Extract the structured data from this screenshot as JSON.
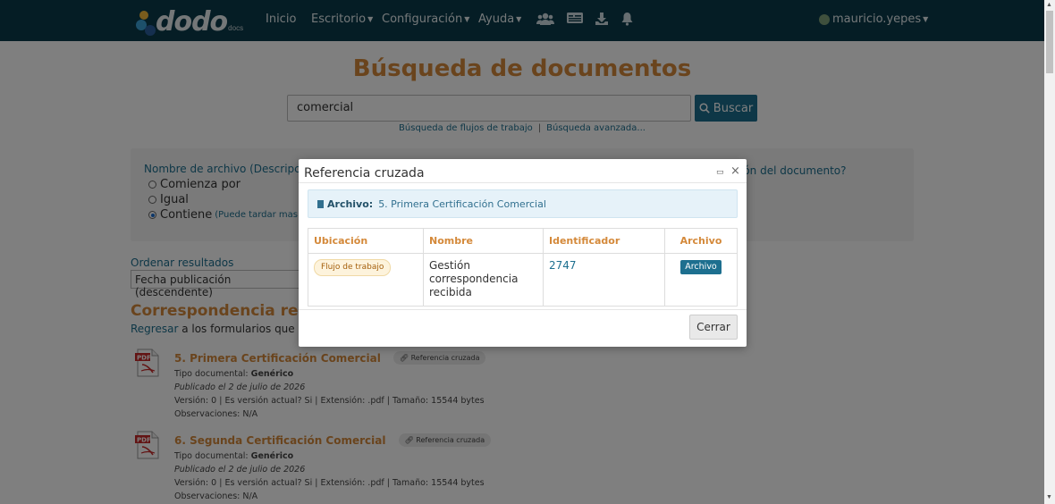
{
  "navbar": {
    "brand_word": "dodo",
    "brand_sub": "docs",
    "items": [
      {
        "label": "Inicio",
        "has_caret": false
      },
      {
        "label": "Escritorio",
        "has_caret": true
      },
      {
        "label": "Configuración",
        "has_caret": true
      },
      {
        "label": "Ayuda",
        "has_caret": true
      }
    ],
    "icons": [
      "users-icon",
      "id-card-icon",
      "download-icon",
      "bell-icon"
    ],
    "user": "mauricio.yepes"
  },
  "page": {
    "title": "Búsqueda de documentos",
    "search_value": "comercial",
    "search_button": "Buscar",
    "link_workflows": "Búsqueda de flujos de trabajo",
    "link_separator": "|",
    "link_advanced": "Búsqueda avanzada...",
    "filename_label": "Nombre de archivo (Descripción",
    "right_question": "ión del documento?",
    "radio_options": [
      {
        "label": "Comienza por",
        "checked": false
      },
      {
        "label": "Igual",
        "checked": false
      },
      {
        "label": "Contiene",
        "checked": true,
        "note": "(Puede tardar mas de"
      }
    ],
    "order_label": "Ordenar resultados",
    "order_value": "Fecha publicación (descendente)",
    "section_title": "Correspondencia recibi",
    "back_link": "Regresar",
    "back_text": " a los formularios que con"
  },
  "results": [
    {
      "title": "5. Primera Certificación Comercial",
      "xref": "Referencia cruzada",
      "doc_type_label": "Tipo documental: ",
      "doc_type": "Genérico",
      "published": "Publicado el 2 de julio de 2026",
      "meta": "Versión: 0 | Es versión actual? Si | Extensión: .pdf | Tamaño: 15544 bytes",
      "observations": "Observaciones: N/A"
    },
    {
      "title": "6. Segunda Certificación Comercial",
      "xref": "Referencia cruzada",
      "doc_type_label": "Tipo documental: ",
      "doc_type": "Genérico",
      "published": "Publicado el 2 de julio de 2026",
      "meta": "Versión: 0 | Es versión actual? Si | Extensión: .pdf | Tamaño: 15544 bytes",
      "observations": "Observaciones: N/A"
    }
  ],
  "modal": {
    "title": "Referencia cruzada",
    "archive_label": "Archivo:",
    "archive_value": "5. Primera Certificación Comercial",
    "headers": {
      "location": "Ubicación",
      "name": "Nombre",
      "id": "Identificador",
      "archive": "Archivo"
    },
    "row": {
      "location": "Flujo de trabajo",
      "name": "Gestión correspondencia recibida",
      "id": "2747",
      "archive": "Archivo"
    },
    "close_button": "Cerrar"
  }
}
